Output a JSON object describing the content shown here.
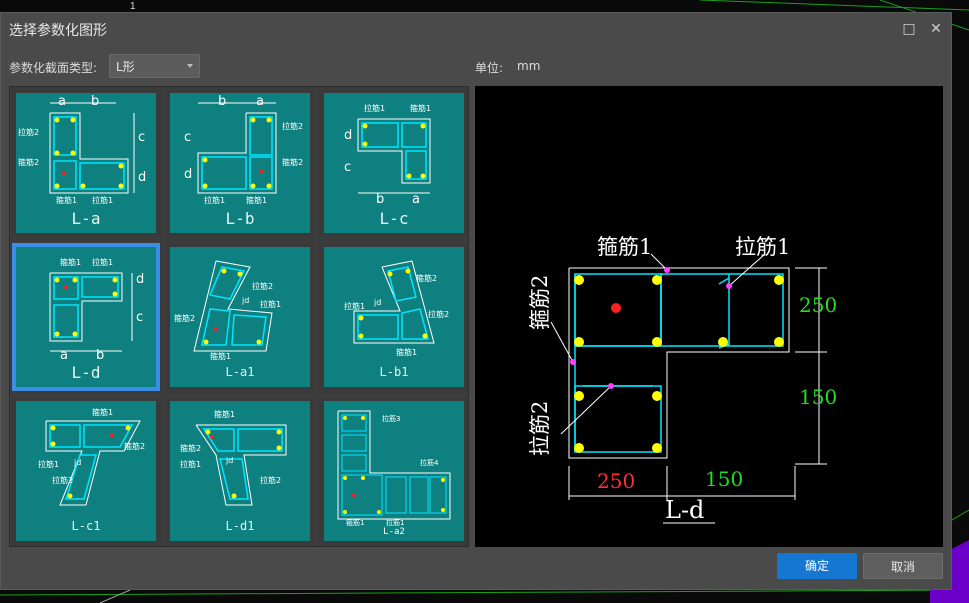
{
  "dialog": {
    "title": "选择参数化图形",
    "maximize_icon": "□",
    "close_icon": "✕"
  },
  "form": {
    "type_label": "参数化截面类型:",
    "type_value": "L形",
    "unit_label": "单位:",
    "unit_value": "mm"
  },
  "thumbnails": [
    {
      "label": "L-a",
      "selected": false
    },
    {
      "label": "L-b",
      "selected": false
    },
    {
      "label": "L-c",
      "selected": false
    },
    {
      "label": "L-d",
      "selected": true
    },
    {
      "label": "L-a1",
      "selected": false
    },
    {
      "label": "L-b1",
      "selected": false
    },
    {
      "label": "L-c1",
      "selected": false
    },
    {
      "label": "L-d1",
      "selected": false
    },
    {
      "label": "L-a2",
      "selected": false
    }
  ],
  "thumbnail_text": {
    "a": "a",
    "b": "b",
    "c": "c",
    "d": "d",
    "jd": "jd",
    "stirrup1": "箍筋1",
    "stirrup2": "箍筋2",
    "tie1": "拉筋1",
    "tie2": "拉筋2",
    "tie3": "拉筋3",
    "tie4": "拉筋4"
  },
  "preview": {
    "name": "L-d",
    "stirrup1": "箍筋1",
    "tie1": "拉筋1",
    "stirrup2": "箍筋2",
    "tie2": "拉筋2",
    "dim_right_top": "250",
    "dim_right_bottom": "150",
    "dim_bottom_left": "250",
    "dim_bottom_right": "150"
  },
  "buttons": {
    "ok": "确定",
    "cancel": "取消"
  },
  "colors": {
    "thumb_bg": "#0f8080",
    "selected_border": "#3a8ee6",
    "rebar_line": "#00e5ff",
    "rebar_dot": "#ffff00",
    "marker": "#ff00ff",
    "dim_green": "#22dd22",
    "dim_red": "#ff3030"
  }
}
